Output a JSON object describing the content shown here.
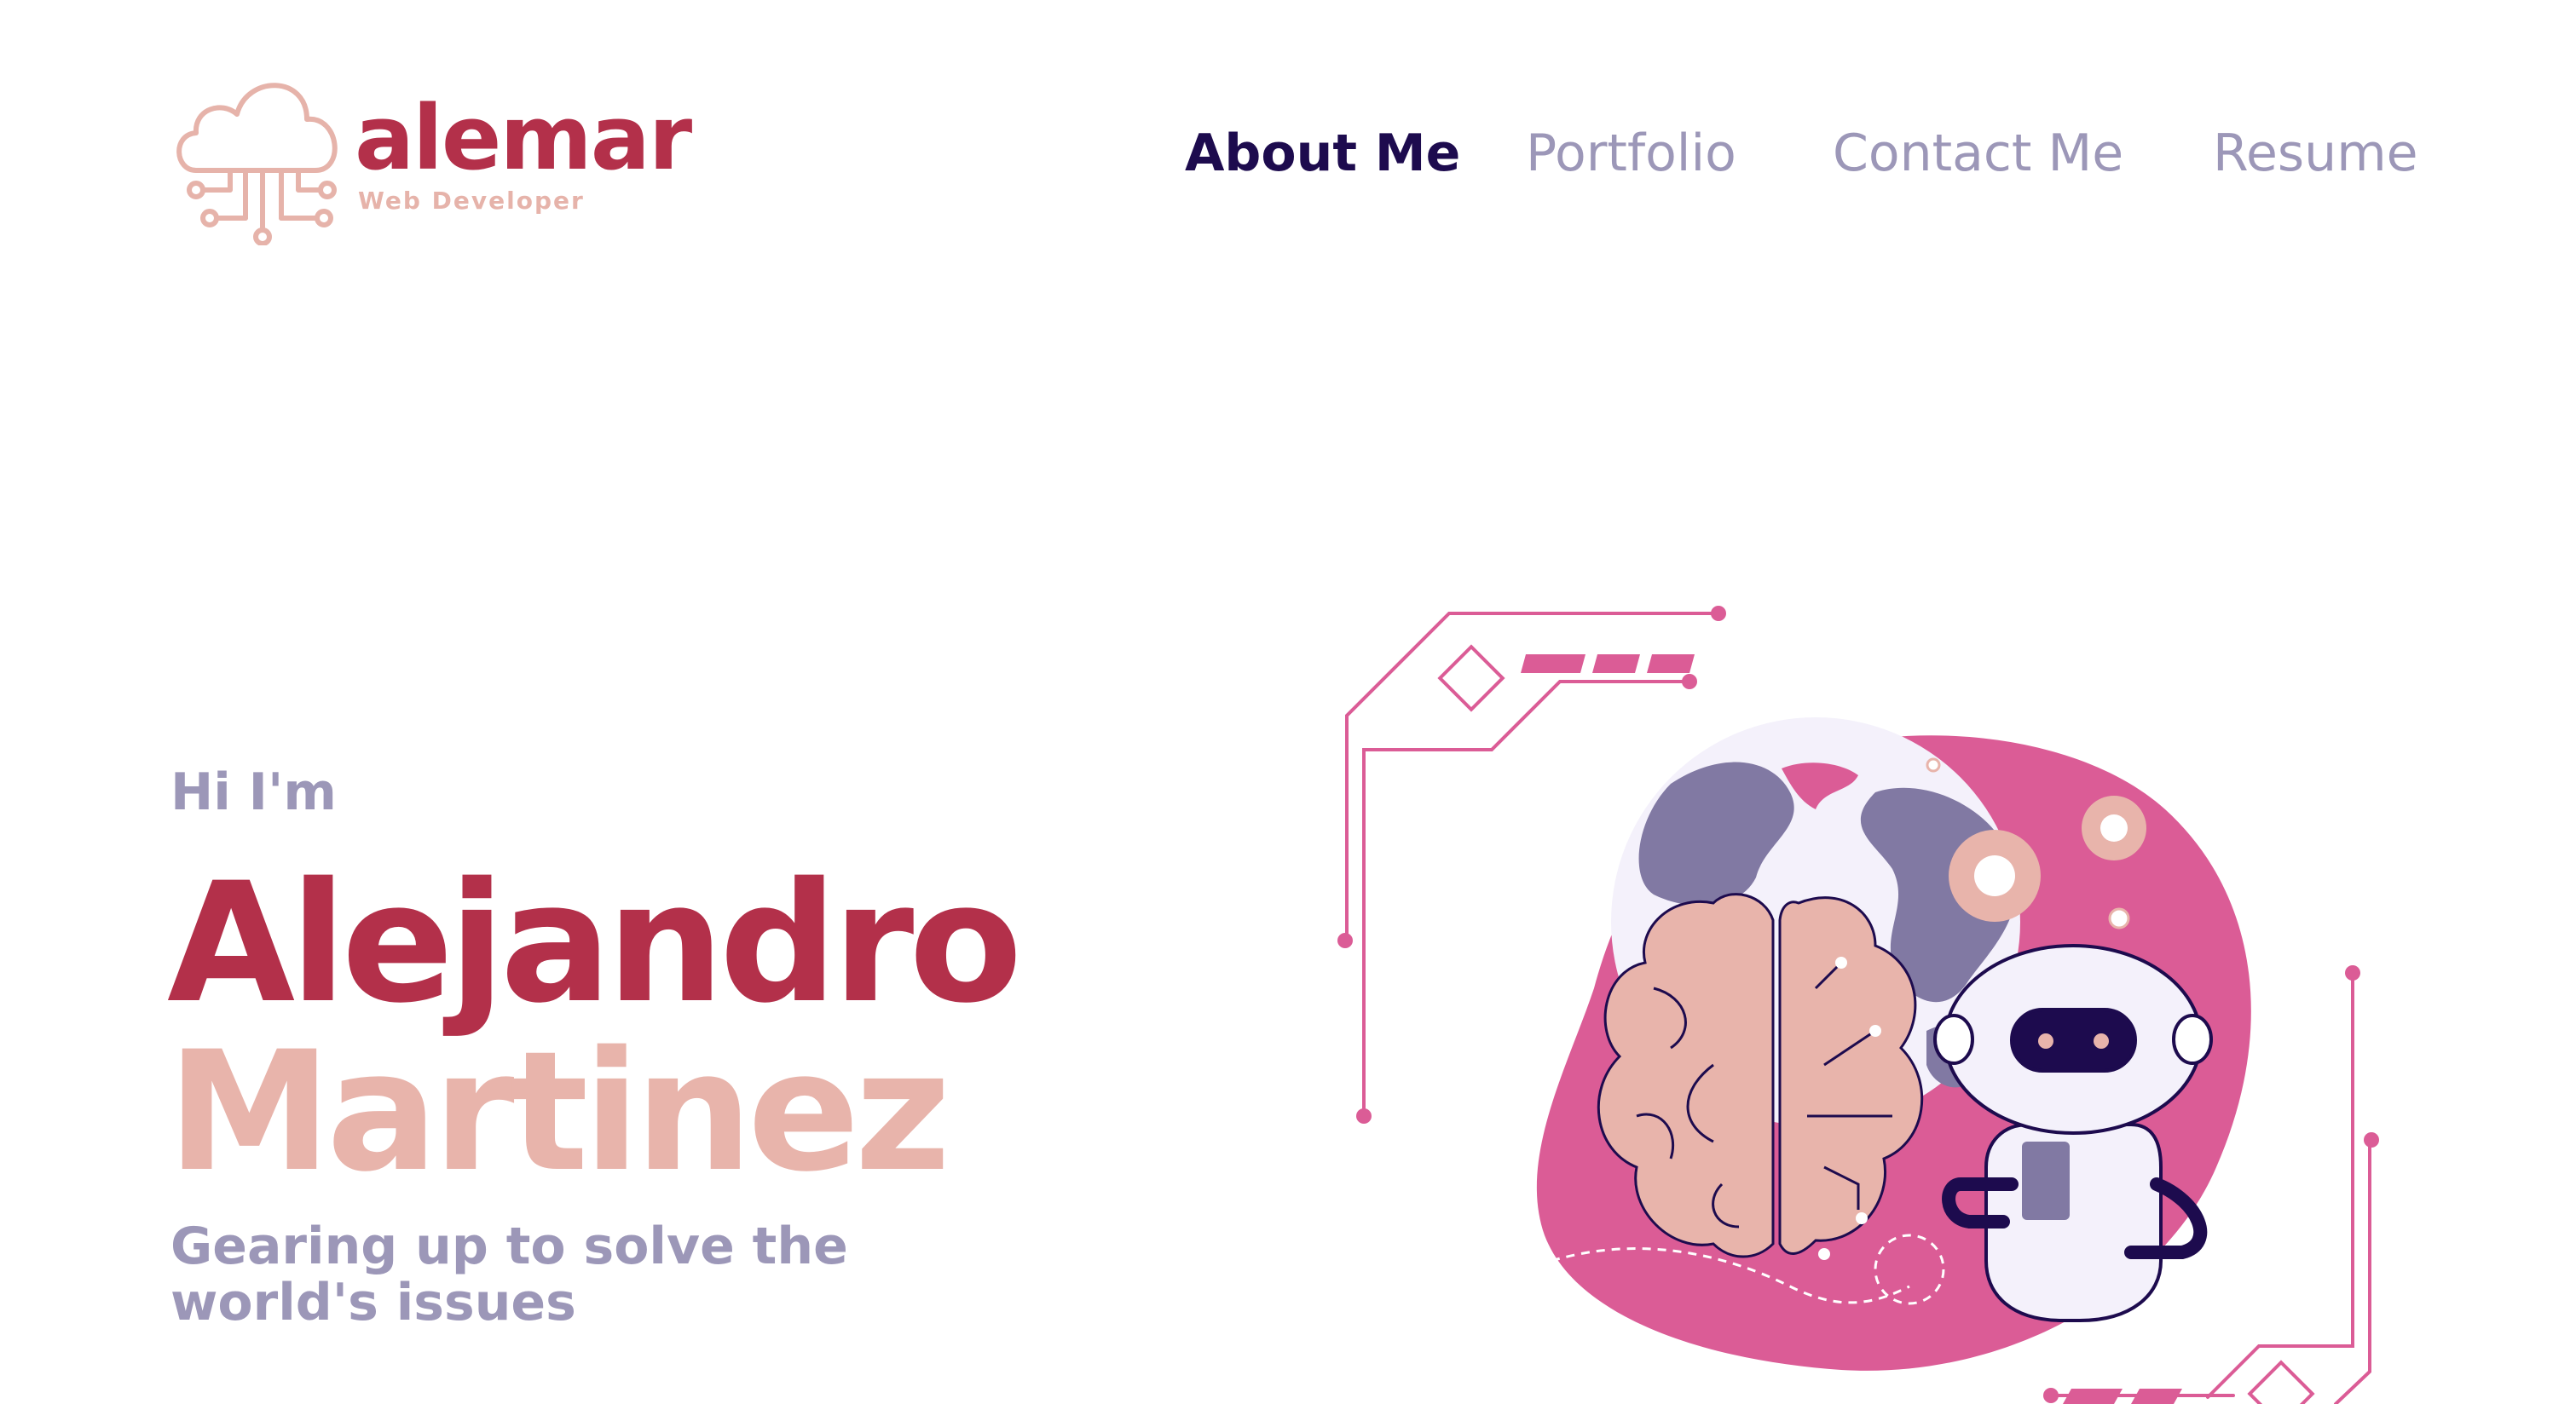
{
  "logo": {
    "name": "alemar",
    "tagline": "Web Developer"
  },
  "nav": [
    {
      "label": "About Me",
      "active": true
    },
    {
      "label": "Portfolio",
      "active": false
    },
    {
      "label": "Contact Me",
      "active": false
    },
    {
      "label": "Resume",
      "active": false
    }
  ],
  "hero": {
    "greeting": "Hi I'm",
    "first_name": "Alejandro",
    "last_name": "Martinez",
    "tagline": "Gearing up to solve the world's issues"
  },
  "colors": {
    "brand": "#b3304a",
    "accent_pink": "#db5c96",
    "light_pink": "#e8b4ab",
    "navy": "#1d0b4e",
    "muted": "#9c97b8"
  },
  "illustration": {
    "icons": [
      "cloud-circuit-icon",
      "brain-icon",
      "globe-icon",
      "robot-icon",
      "gear-icon"
    ]
  }
}
